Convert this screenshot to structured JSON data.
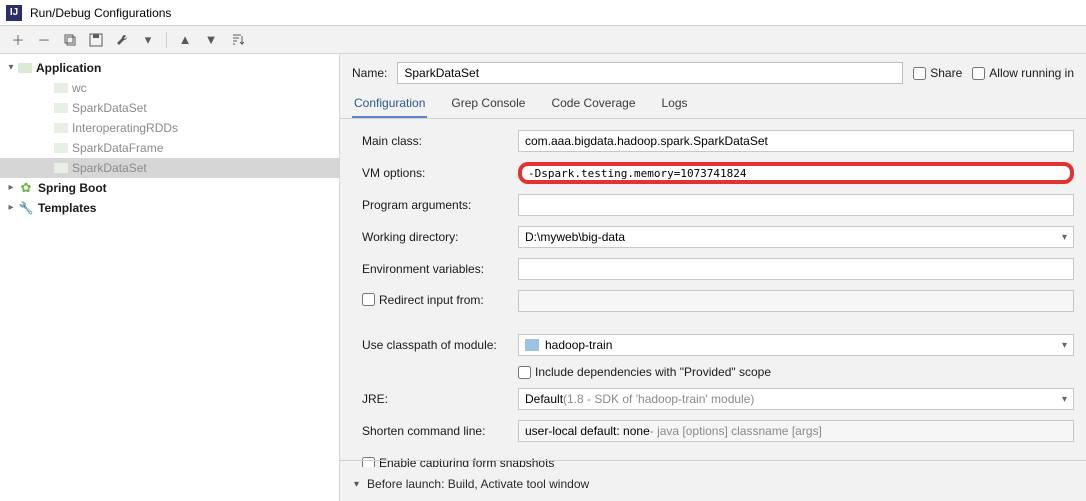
{
  "window": {
    "title": "Run/Debug Configurations",
    "app_icon_text": "IJ"
  },
  "sidebar": {
    "items": [
      {
        "label": "Application",
        "icon": "app",
        "expanded": true,
        "level": 0,
        "bold": true,
        "children": [
          {
            "label": "wc",
            "muted": true,
            "level": 2
          },
          {
            "label": "SparkDataSet",
            "muted": true,
            "level": 2
          },
          {
            "label": "InteroperatingRDDs",
            "muted": true,
            "level": 2
          },
          {
            "label": "SparkDataFrame",
            "muted": true,
            "level": 2
          },
          {
            "label": "SparkDataSet",
            "muted": true,
            "level": 2,
            "selected": true
          }
        ]
      },
      {
        "label": "Spring Boot",
        "icon": "spring",
        "expanded": false,
        "level": 0,
        "bold": true
      },
      {
        "label": "Templates",
        "icon": "tmpl",
        "expanded": false,
        "level": 0,
        "bold": true
      }
    ]
  },
  "header": {
    "name_label": "Name:",
    "name_value": "SparkDataSet",
    "share_label": "Share",
    "allow_running_label": "Allow running in"
  },
  "tabs": [
    {
      "label": "Configuration",
      "active": true
    },
    {
      "label": "Grep Console",
      "active": false
    },
    {
      "label": "Code Coverage",
      "active": false
    },
    {
      "label": "Logs",
      "active": false
    }
  ],
  "form": {
    "main_class": {
      "label": "Main class:",
      "value": "com.aaa.bigdata.hadoop.spark.SparkDataSet"
    },
    "vm_options": {
      "label": "VM options:",
      "value": "-Dspark.testing.memory=1073741824"
    },
    "program_arguments": {
      "label": "Program arguments:",
      "value": ""
    },
    "working_directory": {
      "label": "Working directory:",
      "value": "D:\\myweb\\big-data"
    },
    "environment_variables": {
      "label": "Environment variables:",
      "value": ""
    },
    "redirect_input": {
      "label": "Redirect input from:",
      "value": "",
      "checked": false
    },
    "use_classpath": {
      "label": "Use classpath of module:",
      "value": "hadoop-train"
    },
    "include_deps": {
      "label": "Include dependencies with \"Provided\" scope",
      "checked": false
    },
    "jre": {
      "label": "JRE:",
      "value": "Default",
      "hint": "(1.8 - SDK of 'hadoop-train' module)"
    },
    "shorten_cmd": {
      "label": "Shorten command line:",
      "value": "user-local default: none",
      "hint": " - java [options] classname [args]"
    },
    "enable_capture": {
      "label": "Enable capturing form snapshots",
      "checked": false
    }
  },
  "before_launch": {
    "label": "Before launch: Build, Activate tool window"
  }
}
